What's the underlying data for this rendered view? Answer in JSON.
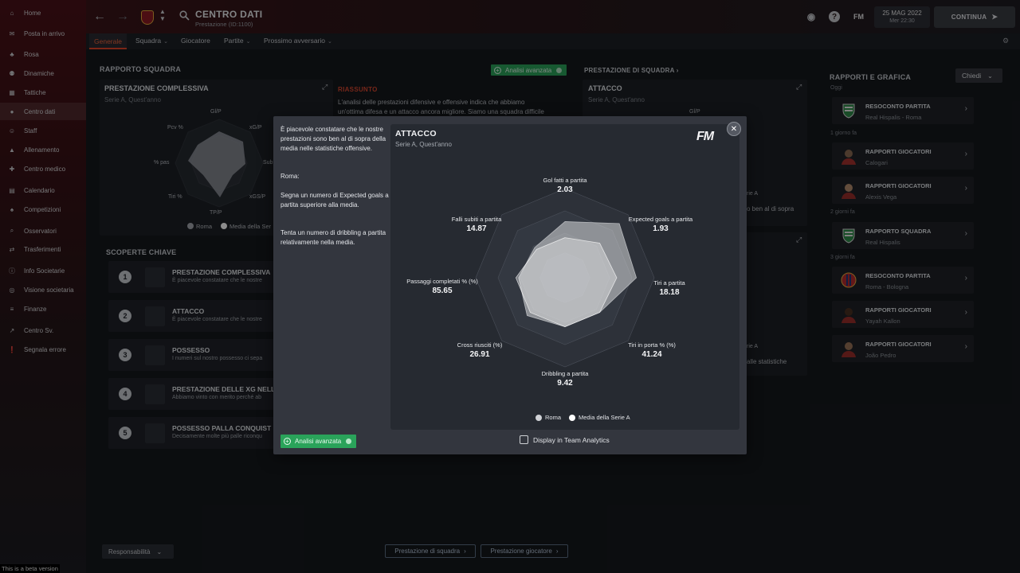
{
  "sidebar": {
    "items": [
      {
        "label": "Home",
        "icon": "home-icon"
      },
      {
        "label": "Posta in arrivo",
        "icon": "inbox-icon"
      },
      {
        "label": "Rosa",
        "icon": "shirt-icon"
      },
      {
        "label": "Dinamiche",
        "icon": "people-icon"
      },
      {
        "label": "Tattiche",
        "icon": "board-icon"
      },
      {
        "label": "Centro dati",
        "icon": "data-icon"
      },
      {
        "label": "Staff",
        "icon": "staff-icon"
      },
      {
        "label": "Allenamento",
        "icon": "cone-icon"
      },
      {
        "label": "Centro medico",
        "icon": "medical-icon"
      },
      {
        "label": "Calendario",
        "icon": "calendar-icon"
      },
      {
        "label": "Competizioni",
        "icon": "trophy-icon"
      },
      {
        "label": "Osservatori",
        "icon": "scout-icon"
      },
      {
        "label": "Trasferimenti",
        "icon": "transfer-icon"
      },
      {
        "label": "Info Societarie",
        "icon": "club-info-icon"
      },
      {
        "label": "Visione societaria",
        "icon": "vision-icon"
      },
      {
        "label": "Finanze",
        "icon": "finance-icon"
      },
      {
        "label": "Centro Sv.",
        "icon": "development-icon"
      },
      {
        "label": "Segnala errore",
        "icon": "bug-report-icon"
      }
    ],
    "beta_notice": "This is a beta version"
  },
  "header": {
    "title": "CENTRO DATI",
    "subtitle": "Prestazione (ID:1100)",
    "fm_label": "FM",
    "date": "25 MAG 2022",
    "time": "Mer 22:30",
    "continue_label": "CONTINUA"
  },
  "tabs": [
    {
      "label": "Generale",
      "dropdown": false
    },
    {
      "label": "Squadra",
      "dropdown": true
    },
    {
      "label": "Giocatore",
      "dropdown": false
    },
    {
      "label": "Partite",
      "dropdown": true
    },
    {
      "label": "Prossimo avversario",
      "dropdown": true
    }
  ],
  "left": {
    "section_title": "RAPPORTO SQUADRA",
    "advanced_btn": "Analisi avanzata",
    "perf": {
      "title": "PRESTAZIONE COMPLESSIVA",
      "subtitle": "Serie A, Quest'anno",
      "axes": [
        "Gl/P",
        "xG/P",
        "Sub",
        "xGS/P",
        "TP/P",
        "Tiri %",
        "% pas",
        "Pcv %"
      ],
      "legend": [
        "Roma",
        "Media della Ser"
      ]
    },
    "summary": {
      "label": "RIASSUNTO",
      "lines": [
        "L'analisi delle prestazioni difensive e offensive indica che abbiamo",
        "un'ottima difesa e un attacco ancora migliore. Siamo una squadra difficile"
      ]
    },
    "key_title": "SCOPERTE CHIAVE",
    "key_rows": [
      {
        "num": "1",
        "title": "PRESTAZIONE COMPLESSIVA",
        "desc": "È piacevole constatare che le nostre"
      },
      {
        "num": "2",
        "title": "ATTACCO",
        "desc": "È piacevole constatare che le nostre"
      },
      {
        "num": "3",
        "title": "POSSESSO",
        "desc": "I numeri sul nostro possesso ci sepa"
      },
      {
        "num": "4",
        "title": "PRESTAZIONE DELLE XG NELL",
        "desc": "Abbiamo vinto con merito perché ab"
      },
      {
        "num": "5",
        "title": "POSSESSO PALLA CONQUIST",
        "desc": "Decisamente molte più palle riconqu"
      }
    ],
    "responsibility": "Responsabilità"
  },
  "middle": {
    "section_link": "PRESTAZIONE DI SQUADRA",
    "attack_title": "ATTACCO",
    "attack_subtitle": "Serie A, Quest'anno",
    "axis_top": "Gl/P",
    "frag1": "rie A",
    "frag2": "o ben al di sopra",
    "frag3": "rie A",
    "frag4": "alle statistiche",
    "btn_team": "Prestazione di squadra",
    "btn_player": "Prestazione giocatore"
  },
  "right": {
    "title": "RAPPORTI E GRAFICA",
    "ask_label": "Chiedi",
    "groups": [
      {
        "time": "Oggi"
      },
      {
        "time": "1 giorno fa"
      },
      {
        "time": "2 giorni fa"
      },
      {
        "time": "3 giorni fa"
      }
    ],
    "reports": [
      {
        "title": "RESOCONTO PARTITA",
        "sub": "Real Hispalis - Roma"
      },
      {
        "title": "RAPPORTI GIOCATORI",
        "sub": "Calogari"
      },
      {
        "title": "RAPPORTI GIOCATORI",
        "sub": "Alexis Vega"
      },
      {
        "title": "RAPPORTO SQUADRA",
        "sub": "Real Hispalis"
      },
      {
        "title": "RESOCONTO PARTITA",
        "sub": "Roma - Bologna"
      },
      {
        "title": "RAPPORTI GIOCATORI",
        "sub": "Yayah Kallon"
      },
      {
        "title": "RAPPORTI GIOCATORI",
        "sub": "João Pedro"
      }
    ]
  },
  "modal": {
    "intro": "È piacevole constatare che le nostre prestazioni sono ben al di sopra della media nelle statistiche offensive.",
    "team": "Roma:",
    "point1": "Segna un numero di Expected goals a partita superiore alla media.",
    "point2": "Tenta un numero di dribbling a partita relativamente nella media.",
    "advanced_btn": "Analisi avanzata",
    "checkbox_label": "Display in Team Analytics",
    "fm_logo": "FM"
  },
  "chart_data": {
    "type": "radar",
    "title": "ATTACCO",
    "subtitle": "Serie A, Quest'anno",
    "axes": [
      {
        "label": "Gol fatti a partita",
        "value": "2.03"
      },
      {
        "label": "Expected goals a partita",
        "value": "1.93"
      },
      {
        "label": "Tiri a partita",
        "value": "18.18"
      },
      {
        "label": "Tiri in porta % (%)",
        "value": "41.24"
      },
      {
        "label": "Dribbling a partita",
        "value": "9.42"
      },
      {
        "label": "Cross riusciti (%)",
        "value": "26.91"
      },
      {
        "label": "Passaggi completati % (%)",
        "value": "85.65"
      },
      {
        "label": "Falli subiti a partita",
        "value": "14.87"
      }
    ],
    "series": [
      {
        "name": "Roma",
        "color": "#d9dadd",
        "relative": [
          0.63,
          0.86,
          0.8,
          0.55,
          0.55,
          0.6,
          0.52,
          0.48
        ]
      },
      {
        "name": "Media della Serie A",
        "color": "#ffffff",
        "relative": [
          0.45,
          0.55,
          0.58,
          0.55,
          0.55,
          0.55,
          0.55,
          0.45
        ]
      }
    ],
    "legend": [
      "Roma",
      "Media della Serie A"
    ]
  }
}
